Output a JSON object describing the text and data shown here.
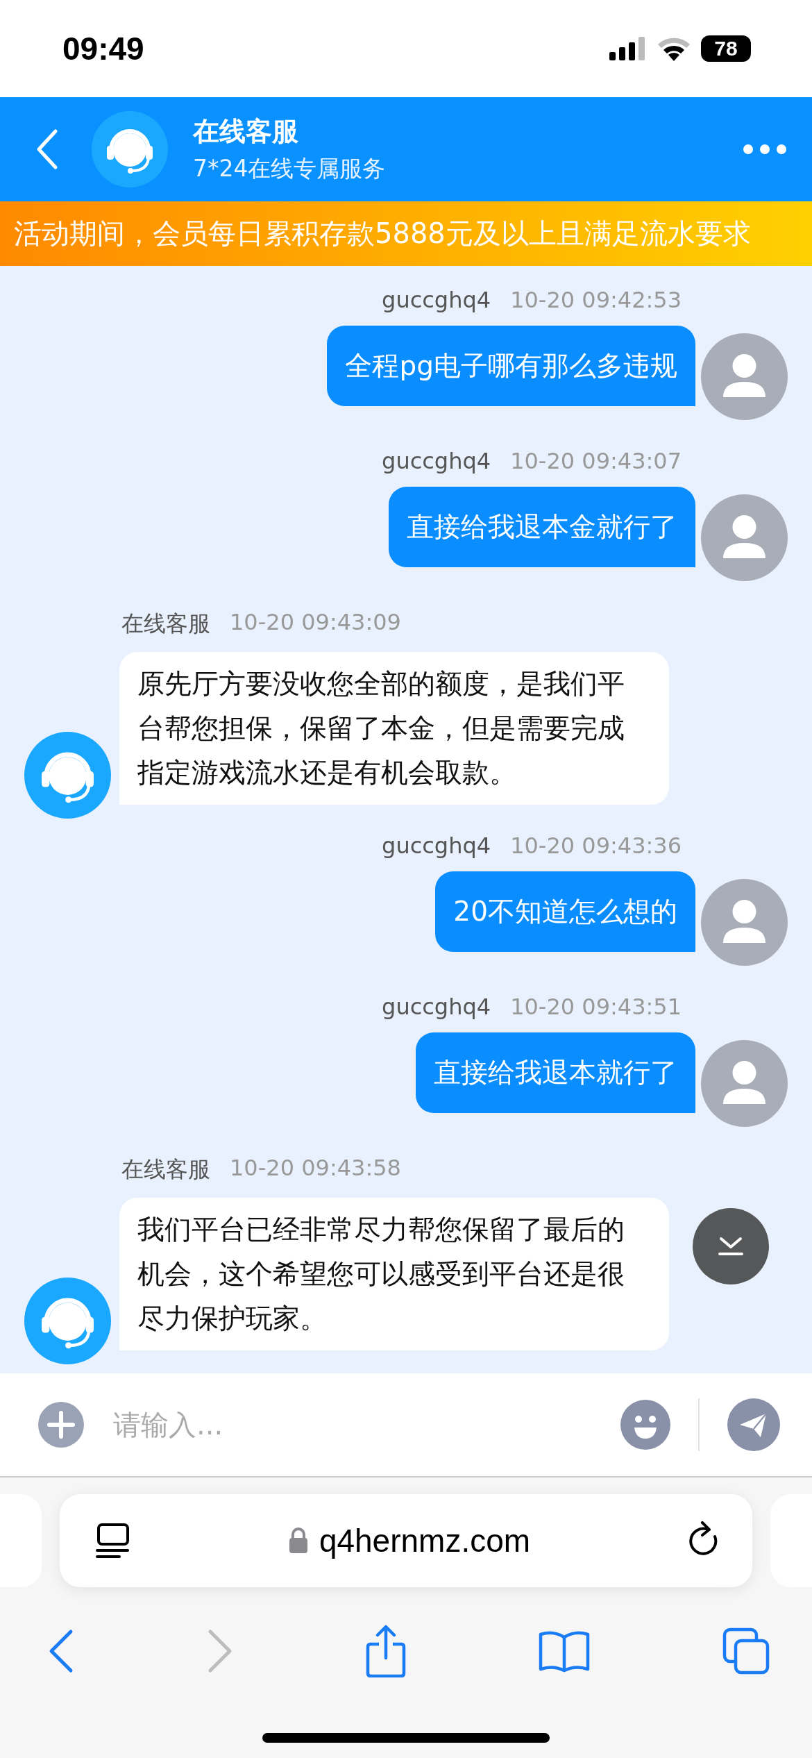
{
  "status_bar": {
    "time": "09:49",
    "battery": "78"
  },
  "header": {
    "title": "在线客服",
    "subtitle": "7*24在线专属服务"
  },
  "marquee": "活动期间，会员每日累积存款5888元及以上且满足流水要求",
  "messages": [
    {
      "kind": "sent",
      "sender": "guccghq4",
      "time": "10-20 09:42:53",
      "text": "全程pg电子哪有那么多违规"
    },
    {
      "kind": "sent",
      "sender": "guccghq4",
      "time": "10-20 09:43:07",
      "text": "直接给我退本金就行了"
    },
    {
      "kind": "received",
      "sender": "在线客服",
      "time": "10-20 09:43:09",
      "text": "原先厅方要没收您全部的额度，是我们平台帮您担保，保留了本金，但是需要完成指定游戏流水还是有机会取款。"
    },
    {
      "kind": "sent",
      "sender": "guccghq4",
      "time": "10-20 09:43:36",
      "text": "20不知道怎么想的"
    },
    {
      "kind": "sent",
      "sender": "guccghq4",
      "time": "10-20 09:43:51",
      "text": "直接给我退本就行了"
    },
    {
      "kind": "received",
      "sender": "在线客服",
      "time": "10-20 09:43:58",
      "text": "我们平台已经非常尽力帮您保留了最后的机会，这个希望您可以感受到平台还是很尽力保护玩家。"
    }
  ],
  "input": {
    "placeholder": "请输入..."
  },
  "browser": {
    "url": "q4hernmz.com",
    "back_disabled": false,
    "forward_disabled": true
  }
}
